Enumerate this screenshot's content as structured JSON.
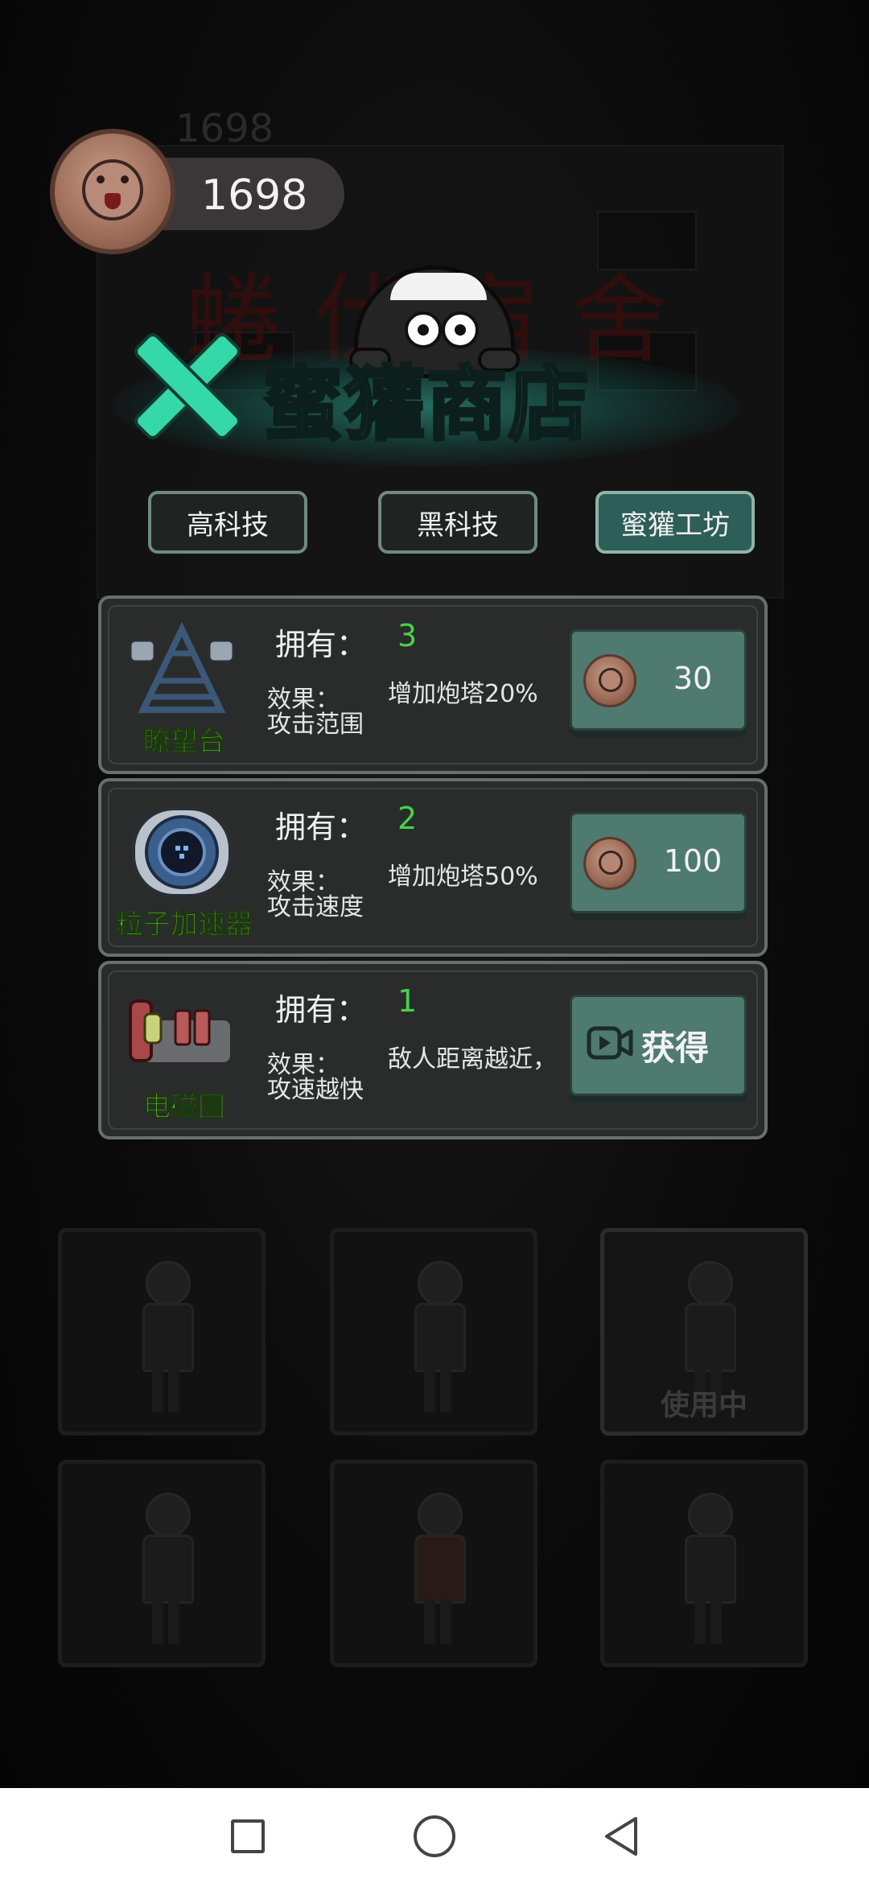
{
  "coins": {
    "value": "1698",
    "ghost_value": "1698"
  },
  "shop": {
    "title": "蜜獾商店",
    "background_title": "蜷伏宿舍"
  },
  "tabs": [
    {
      "label": "高科技",
      "active": false
    },
    {
      "label": "黑科技",
      "active": false
    },
    {
      "label": "蜜獾工坊",
      "active": true
    }
  ],
  "labels": {
    "own": "拥有：",
    "effect": "效果："
  },
  "items": [
    {
      "name": "瞭望台",
      "owned": "3",
      "effect": "增加炮塔20%攻击范围",
      "price": "30",
      "action": "coin"
    },
    {
      "name": "粒子加速器",
      "owned": "2",
      "effect": "增加炮塔50%攻击速度",
      "price": "100",
      "action": "coin"
    },
    {
      "name": "电磁圈",
      "owned": "1",
      "effect": "敌人距离越近，攻速越快",
      "get_label": "获得",
      "action": "video"
    }
  ],
  "characters": {
    "in_use_label": "使用中",
    "count": 6
  },
  "colors": {
    "accent": "#35d8a8",
    "owned_value": "#46d24a",
    "item_name": "#7cdc3a",
    "button": "#4e7a70"
  }
}
